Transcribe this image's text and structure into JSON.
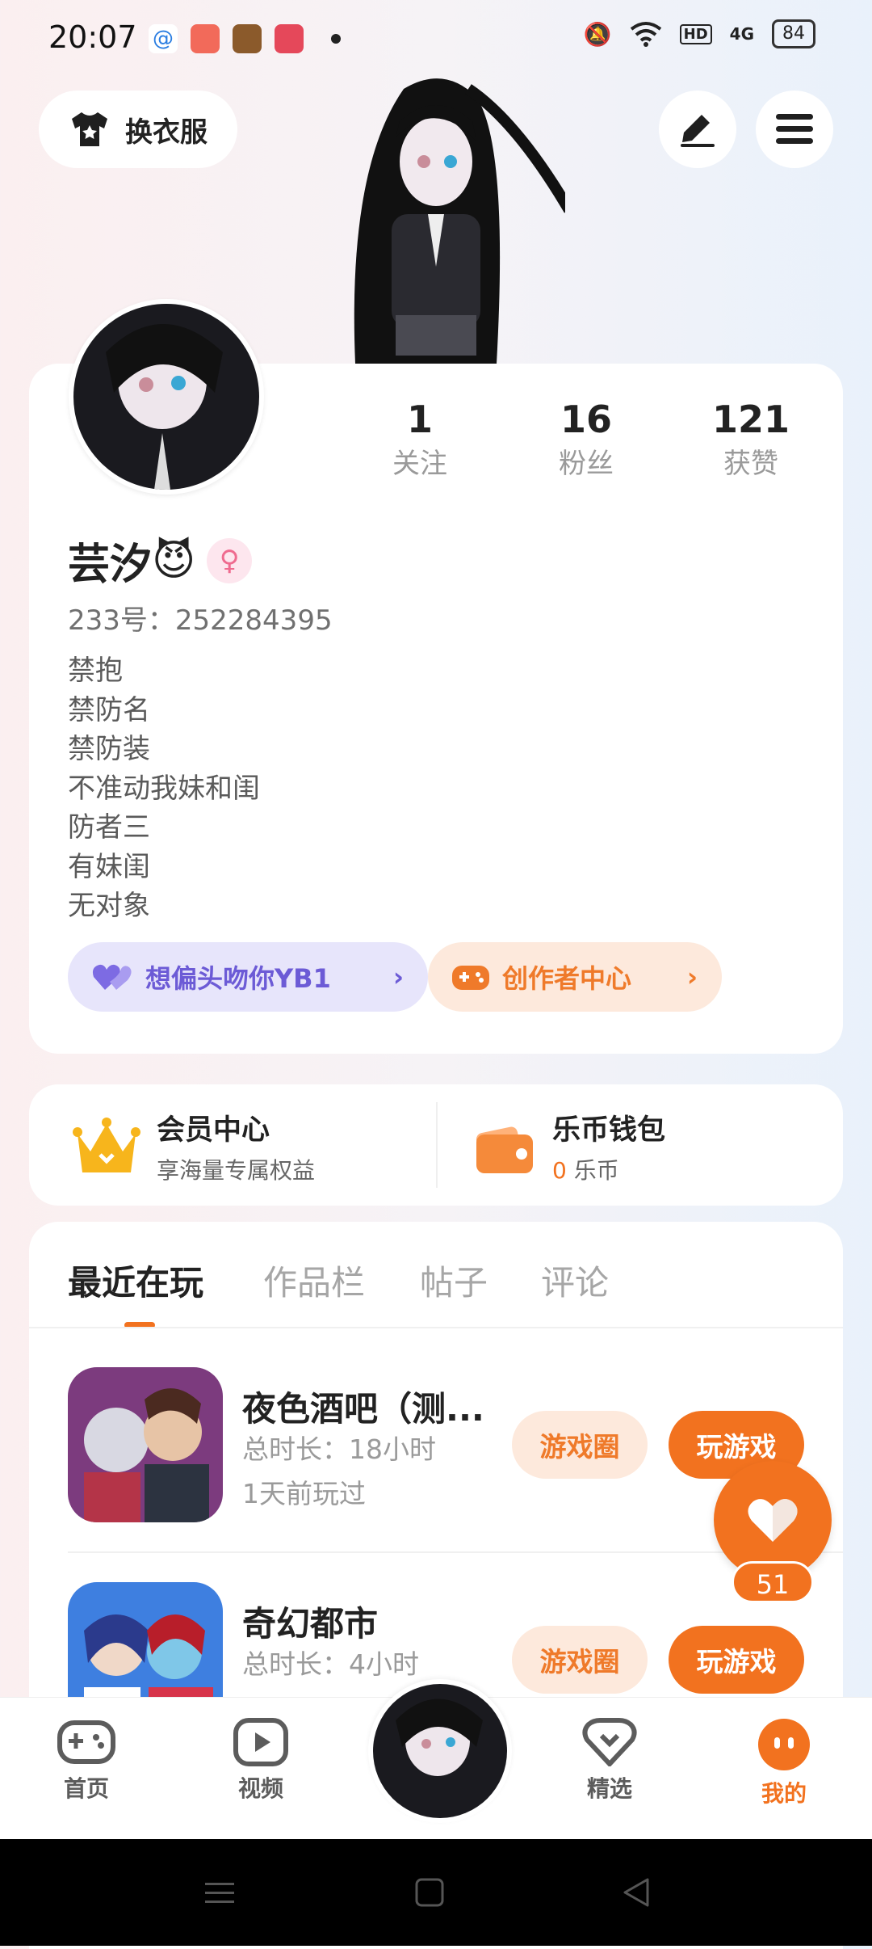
{
  "status_bar": {
    "time": "20:07",
    "network": "4G",
    "hd": "HD",
    "battery": "84"
  },
  "header": {
    "dress_button_label": "换衣服"
  },
  "profile": {
    "stats": [
      {
        "value": "1",
        "label": "关注"
      },
      {
        "value": "16",
        "label": "粉丝"
      },
      {
        "value": "121",
        "label": "获赞"
      }
    ],
    "name": "芸汐",
    "emoji": "😈",
    "gender_symbol": "♀",
    "uid": "233号：252284395",
    "bio": [
      "禁抱",
      "禁防名",
      "禁防装",
      "不准动我妹和闺",
      "防者三",
      "有妹闺",
      "无对象"
    ],
    "chip_left": "想偏头吻你YB1",
    "chip_right": "创作者中心"
  },
  "vip": {
    "member_title": "会员中心",
    "member_sub": "享海量专属权益",
    "wallet_title": "乐币钱包",
    "wallet_amount": "0",
    "wallet_unit": " 乐币"
  },
  "tabs": [
    "最近在玩",
    "作品栏",
    "帖子",
    "评论"
  ],
  "games": [
    {
      "name": "夜色酒吧（测...",
      "duration": "总时长：18小时",
      "last_played": "1天前玩过",
      "circle_btn": "游戏圈",
      "play_btn": "玩游戏"
    },
    {
      "name": "奇幻都市",
      "duration": "总时长：4小时",
      "last_played": "",
      "circle_btn": "游戏圈",
      "play_btn": "玩游戏"
    }
  ],
  "like_count": "51",
  "bottom_nav": {
    "home": "首页",
    "video": "视频",
    "featured": "精选",
    "mine": "我的"
  },
  "colors": {
    "accent": "#f2721f",
    "purple": "#6c5bd6"
  }
}
